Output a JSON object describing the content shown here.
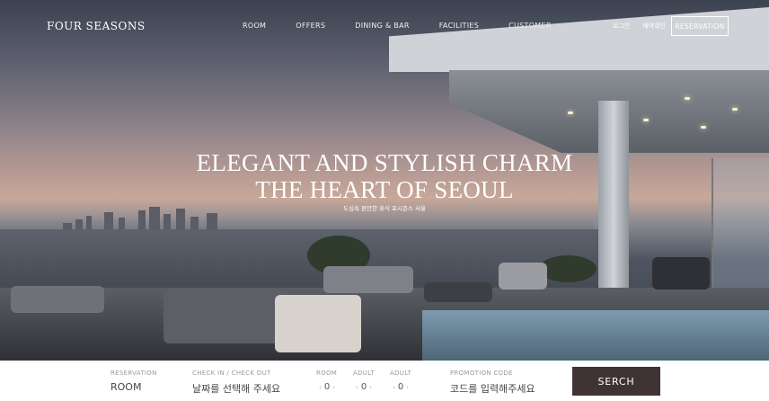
{
  "header": {
    "logo": "FOUR SEASONS",
    "nav": [
      "ROOM",
      "OFFERS",
      "DINING & BAR",
      "FACILITIES",
      "CUSTOMER"
    ],
    "login": "로그인",
    "reservation_check": "예약확인",
    "reservation_button": "RESERVATION"
  },
  "hero": {
    "headline_line1": "ELEGANT AND STYLISH CHARM",
    "headline_line2": "THE HEART OF SEOUL",
    "subline": "도심속 편안한 휴식 포시즌스 서울"
  },
  "booking": {
    "reservation_label": "RESERVATION",
    "reservation_value": "ROOM",
    "checkin_label": "CHECK IN / CHECK OUT",
    "checkin_value": "날짜를 선택해 주세요",
    "room_label": "ROOM",
    "room_value": "0",
    "adult1_label": "ADULT",
    "adult1_value": "0",
    "adult2_label": "ADULT",
    "adult2_value": "0",
    "promo_label": "PROMOTION CODE",
    "promo_placeholder": "코드를 입력해주세요",
    "search_label": "SERCH",
    "decrement_glyph": "‹",
    "increment_glyph": "›"
  },
  "colors": {
    "search_button": "#3f3433",
    "booking_bar": "#ffffff",
    "header_text": "#ffffff"
  }
}
